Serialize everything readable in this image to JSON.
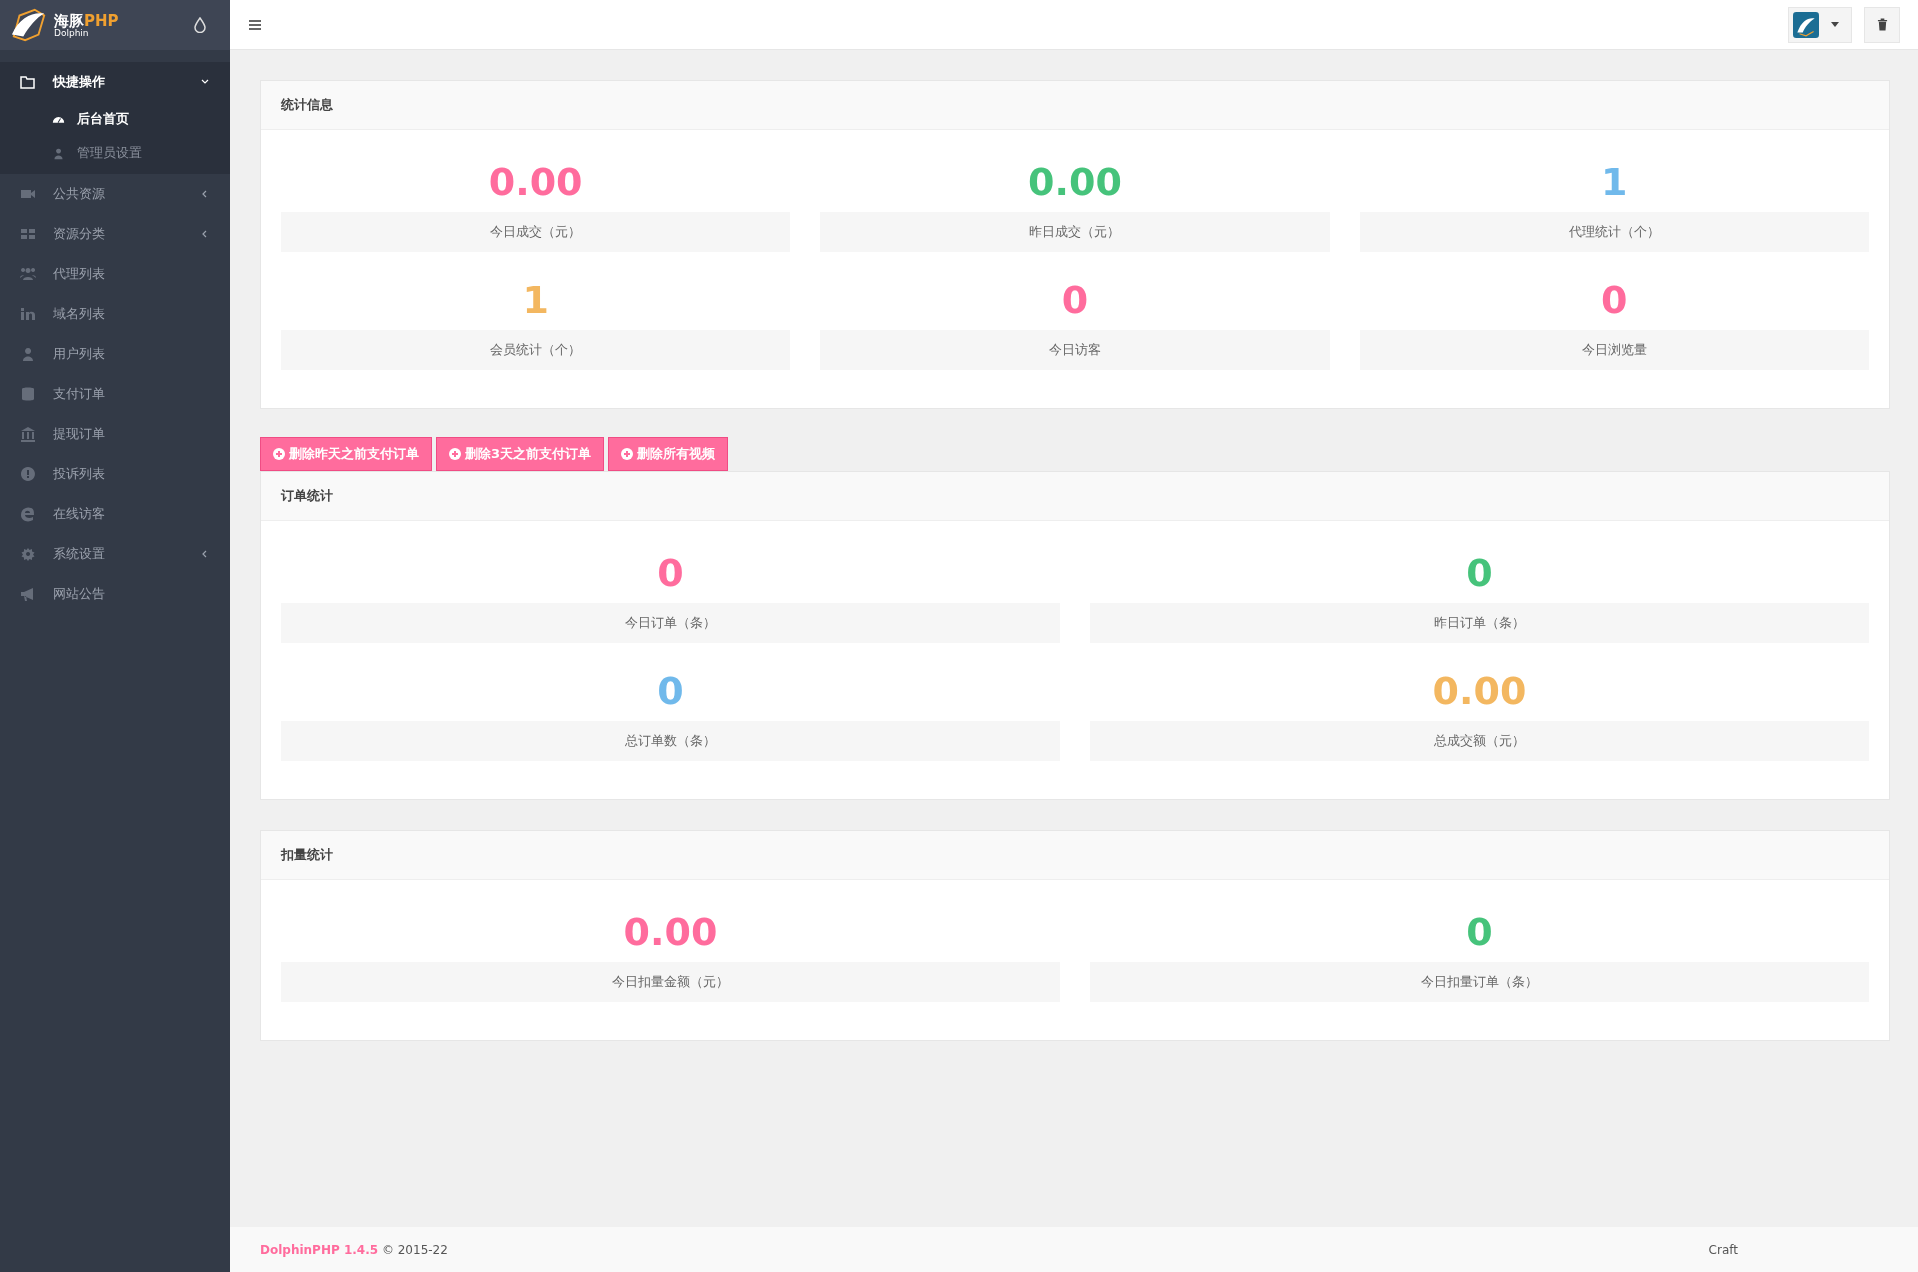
{
  "brand": {
    "name": "海豚",
    "suffix": "PHP",
    "sub": "Dolphin"
  },
  "sidebar": {
    "items": [
      {
        "label": "快捷操作",
        "expanded": true,
        "children": [
          {
            "label": "后台首页",
            "selected": true
          },
          {
            "label": "管理员设置",
            "selected": false
          }
        ]
      },
      {
        "label": "公共资源",
        "expanded": false
      },
      {
        "label": "资源分类",
        "expanded": false
      },
      {
        "label": "代理列表"
      },
      {
        "label": "域名列表"
      },
      {
        "label": "用户列表"
      },
      {
        "label": "支付订单"
      },
      {
        "label": "提现订单"
      },
      {
        "label": "投诉列表"
      },
      {
        "label": "在线访客"
      },
      {
        "label": "系统设置",
        "expanded": false
      },
      {
        "label": "网站公告"
      }
    ]
  },
  "sections": [
    {
      "title": "统计信息",
      "items": [
        {
          "value": "0.00",
          "label": "今日成交（元）",
          "color": "#ff6c9d"
        },
        {
          "value": "0.00",
          "label": "昨日成交（元）",
          "color": "#46c37b"
        },
        {
          "value": "1",
          "label": "代理统计（个）",
          "color": "#70b9eb"
        },
        {
          "value": "1",
          "label": "会员统计（个）",
          "color": "#f3b760"
        },
        {
          "value": "0",
          "label": "今日访客",
          "color": "#ff6c9d"
        },
        {
          "value": "0",
          "label": "今日浏览量",
          "color": "#ff6c9d"
        }
      ]
    },
    {
      "title": "订单统计",
      "actions": [
        "删除昨天之前支付订单",
        "删除3天之前支付订单",
        "删除所有视频"
      ],
      "items": [
        {
          "value": "0",
          "label": "今日订单（条）",
          "color": "#ff6c9d"
        },
        {
          "value": "0",
          "label": "昨日订单（条）",
          "color": "#46c37b"
        },
        {
          "value": "0",
          "label": "总订单数（条）",
          "color": "#70b9eb"
        },
        {
          "value": "0.00",
          "label": "总成交额（元）",
          "color": "#f3b760"
        }
      ]
    },
    {
      "title": "扣量统计",
      "items": [
        {
          "value": "0.00",
          "label": "今日扣量金额（元）",
          "color": "#ff6c9d"
        },
        {
          "value": "0",
          "label": "今日扣量订单（条）",
          "color": "#46c37b"
        }
      ]
    }
  ],
  "footer": {
    "product": "DolphinPHP 1.4.5",
    "copyright": "© 2015-22",
    "right": "Craft"
  }
}
